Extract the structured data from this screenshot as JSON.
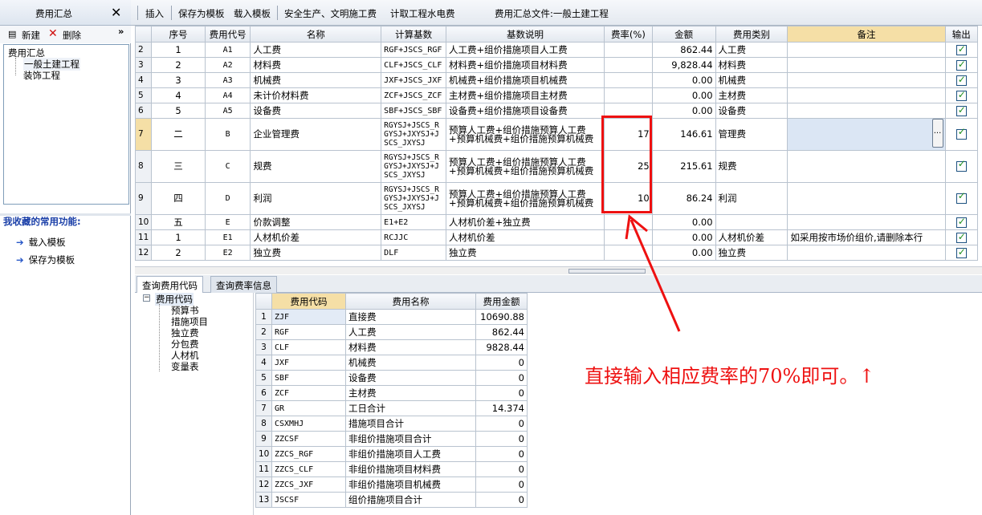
{
  "left_panel": {
    "title": "费用汇总",
    "close_glyph": "✕",
    "new_label": "新建",
    "delete_label": "删除",
    "collapse_glyph": "»",
    "tree": {
      "root": "费用汇总",
      "children": [
        "一般土建工程",
        "装饰工程"
      ]
    },
    "favorites_title": "我收藏的常用功能:",
    "favorites": [
      "载入模板",
      "保存为模板"
    ]
  },
  "toolbar": {
    "items": [
      "插入",
      "保存为模板",
      "载入模板",
      "安全生产、文明施工费",
      "计取工程水电费"
    ],
    "file_label": "费用汇总文件:一般土建工程"
  },
  "main_table": {
    "headers": [
      "序号",
      "费用代号",
      "名称",
      "计算基数",
      "基数说明",
      "费率(%)",
      "金额",
      "费用类别",
      "备注",
      "输出"
    ],
    "rows": [
      {
        "rn": "2",
        "seq": "1",
        "code": "A1",
        "name": "人工费",
        "base": "RGF+JSCS_RGF",
        "desc": "人工费+组价措施项目人工费",
        "rate": "",
        "amount": "862.44",
        "cat": "人工费",
        "remark": ""
      },
      {
        "rn": "3",
        "seq": "2",
        "code": "A2",
        "name": "材料费",
        "base": "CLF+JSCS_CLF",
        "desc": "材料费+组价措施项目材料费",
        "rate": "",
        "amount": "9,828.44",
        "cat": "材料费",
        "remark": ""
      },
      {
        "rn": "4",
        "seq": "3",
        "code": "A3",
        "name": "机械费",
        "base": "JXF+JSCS_JXF",
        "desc": "机械费+组价措施项目机械费",
        "rate": "",
        "amount": "0.00",
        "cat": "机械费",
        "remark": ""
      },
      {
        "rn": "5",
        "seq": "4",
        "code": "A4",
        "name": "未计价材料费",
        "base": "ZCF+JSCS_ZCF",
        "desc": "主材费+组价措施项目主材费",
        "rate": "",
        "amount": "0.00",
        "cat": "主材费",
        "remark": ""
      },
      {
        "rn": "6",
        "seq": "5",
        "code": "A5",
        "name": "设备费",
        "base": "SBF+JSCS_SBF",
        "desc": "设备费+组价措施项目设备费",
        "rate": "",
        "amount": "0.00",
        "cat": "设备费",
        "remark": ""
      },
      {
        "rn": "7",
        "seq": "二",
        "code": "B",
        "name": "企业管理费",
        "base": "RGYSJ+JSCS_RGYSJ+JXYSJ+JSCS_JXYSJ",
        "desc": "预算人工费+组价措施预算人工费+预算机械费+组价措施预算机械费",
        "rate": "17",
        "amount": "146.61",
        "cat": "管理费",
        "remark": ""
      },
      {
        "rn": "8",
        "seq": "三",
        "code": "C",
        "name": "规费",
        "base": "RGYSJ+JSCS_RGYSJ+JXYSJ+JSCS_JXYSJ",
        "desc": "预算人工费+组价措施预算人工费+预算机械费+组价措施预算机械费",
        "rate": "25",
        "amount": "215.61",
        "cat": "规费",
        "remark": ""
      },
      {
        "rn": "9",
        "seq": "四",
        "code": "D",
        "name": "利润",
        "base": "RGYSJ+JSCS_RGYSJ+JXYSJ+JSCS_JXYSJ",
        "desc": "预算人工费+组价措施预算人工费+预算机械费+组价措施预算机械费",
        "rate": "10",
        "amount": "86.24",
        "cat": "利润",
        "remark": ""
      },
      {
        "rn": "10",
        "seq": "五",
        "code": "E",
        "name": "价款调整",
        "base": "E1+E2",
        "desc": "人材机价差+独立费",
        "rate": "",
        "amount": "0.00",
        "cat": "",
        "remark": ""
      },
      {
        "rn": "11",
        "seq": "1",
        "code": "E1",
        "name": "人材机价差",
        "base": "RCJJC",
        "desc": "人材机价差",
        "rate": "",
        "amount": "0.00",
        "cat": "人材机价差",
        "remark": "如采用按市场价组价,请删除本行"
      },
      {
        "rn": "12",
        "seq": "2",
        "code": "E2",
        "name": "独立费",
        "base": "DLF",
        "desc": "独立费",
        "rate": "",
        "amount": "0.00",
        "cat": "独立费",
        "remark": ""
      }
    ],
    "ellipsis_label": "..."
  },
  "bottom_tabs": [
    "查询费用代码",
    "查询费率信息"
  ],
  "code_tree": {
    "root": "费用代码",
    "children": [
      "预算书",
      "措施项目",
      "独立费",
      "分包费",
      "人材机",
      "变量表"
    ]
  },
  "code_table": {
    "headers": [
      "费用代码",
      "费用名称",
      "费用金额"
    ],
    "rows": [
      {
        "rn": "1",
        "code": "ZJF",
        "name": "直接费",
        "amount": "10690.88"
      },
      {
        "rn": "2",
        "code": "RGF",
        "name": "人工费",
        "amount": "862.44"
      },
      {
        "rn": "3",
        "code": "CLF",
        "name": "材料费",
        "amount": "9828.44"
      },
      {
        "rn": "4",
        "code": "JXF",
        "name": "机械费",
        "amount": "0"
      },
      {
        "rn": "5",
        "code": "SBF",
        "name": "设备费",
        "amount": "0"
      },
      {
        "rn": "6",
        "code": "ZCF",
        "name": "主材费",
        "amount": "0"
      },
      {
        "rn": "7",
        "code": "GR",
        "name": "工日合计",
        "amount": "14.374"
      },
      {
        "rn": "8",
        "code": "CSXMHJ",
        "name": "措施项目合计",
        "amount": "0"
      },
      {
        "rn": "9",
        "code": "ZZCSF",
        "name": "非组价措施项目合计",
        "amount": "0"
      },
      {
        "rn": "10",
        "code": "ZZCS_RGF",
        "name": "非组价措施项目人工费",
        "amount": "0"
      },
      {
        "rn": "11",
        "code": "ZZCS_CLF",
        "name": "非组价措施项目材料费",
        "amount": "0"
      },
      {
        "rn": "12",
        "code": "ZZCS_JXF",
        "name": "非组价措施项目机械费",
        "amount": "0"
      },
      {
        "rn": "13",
        "code": "JSCSF",
        "name": "组价措施项目合计",
        "amount": "0"
      }
    ]
  },
  "annotation": {
    "text": "直接输入相应费率的70%即可。↑",
    "color": "#ee1111"
  }
}
